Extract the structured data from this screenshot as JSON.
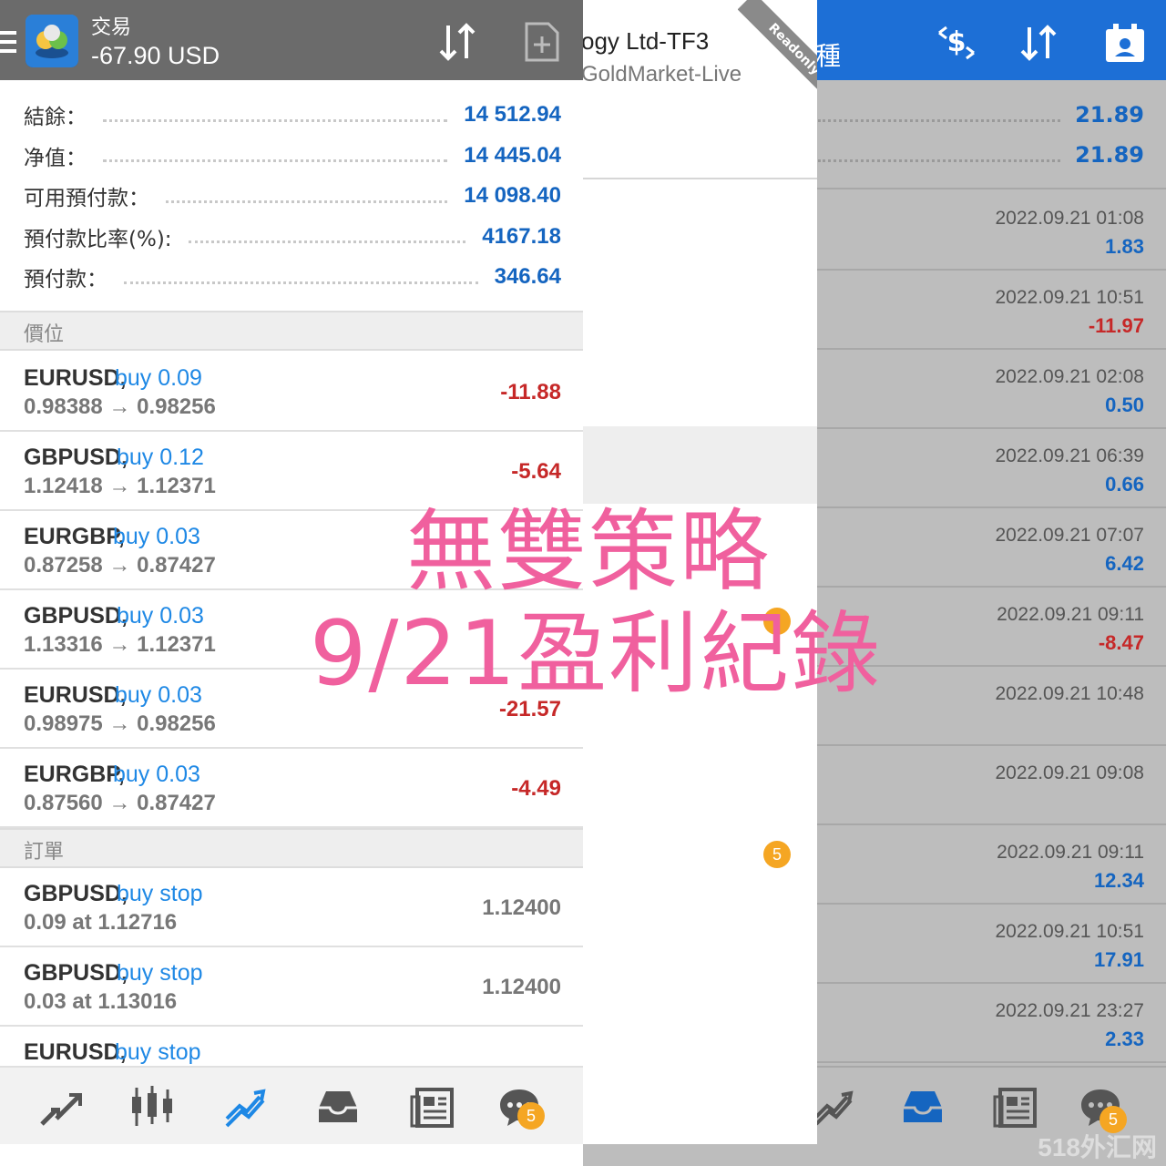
{
  "colors": {
    "header_grey": "#6b6b6b",
    "header_blue": "#1d6fd6",
    "profit_blue": "#1565c0",
    "loss_red": "#c62828",
    "overlay_pink": "#f0609e",
    "badge_orange": "#f5a623"
  },
  "left": {
    "header": {
      "title": "交易",
      "profit": "-67.90 USD",
      "icons": [
        "menu-icon",
        "app-logo-icon",
        "sort-icon",
        "new-order-icon"
      ]
    },
    "account": [
      {
        "label": "結餘：",
        "value": "14 512.94"
      },
      {
        "label": "净值：",
        "value": "14 445.04"
      },
      {
        "label": "可用預付款：",
        "value": "14 098.40"
      },
      {
        "label": "預付款比率(%):",
        "value": "4167.18"
      },
      {
        "label": "預付款：",
        "value": "346.64"
      }
    ],
    "positions_header": "價位",
    "positions": [
      {
        "symbol": "EURUSD,",
        "side": "buy 0.09",
        "prices": "0.98388 → 0.98256",
        "pl": "-11.88"
      },
      {
        "symbol": "GBPUSD,",
        "side": "buy 0.12",
        "prices": "1.12418 → 1.12371",
        "pl": "-5.64"
      },
      {
        "symbol": "EURGBP,",
        "side": "buy 0.03",
        "prices": "0.87258 → 0.87427",
        "pl": ""
      },
      {
        "symbol": "GBPUSD,",
        "side": "buy 0.03",
        "prices": "1.13316 → 1.12371",
        "pl": ""
      },
      {
        "symbol": "EURUSD,",
        "side": "buy 0.03",
        "prices": "0.98975 → 0.98256",
        "pl": "-21.57"
      },
      {
        "symbol": "EURGBP,",
        "side": "buy 0.03",
        "prices": "0.87560 → 0.87427",
        "pl": "-4.49"
      }
    ],
    "orders_header": "訂單",
    "orders": [
      {
        "symbol": "GBPUSD,",
        "side": "buy stop",
        "detail": "0.09 at 1.12716",
        "price": "1.12400"
      },
      {
        "symbol": "GBPUSD,",
        "side": "buy stop",
        "detail": "0.03 at 1.13016",
        "price": "1.12400"
      },
      {
        "symbol": "EURUSD,",
        "side": "buy stop",
        "detail": "",
        "price": ""
      }
    ],
    "bottom_nav": [
      "quotes-icon",
      "chart-icon",
      "trade-icon",
      "history-icon",
      "news-icon",
      "chat-icon"
    ],
    "chat_badge": "5"
  },
  "middle": {
    "company": "ogy Ltd-TF3",
    "server": "GoldMarket-Live",
    "ribbon": "Readonly",
    "badge": "5"
  },
  "right": {
    "header": {
      "partial_title": "種",
      "icons": [
        "currency-exchange-icon",
        "sort-icon",
        "calendar-icon"
      ]
    },
    "summary": [
      "21.89",
      "21.89"
    ],
    "history": [
      {
        "time": "2022.09.21 01:08",
        "amount": "1.83",
        "type": "pos"
      },
      {
        "time": "2022.09.21 10:51",
        "amount": "-11.97",
        "type": "neg"
      },
      {
        "time": "2022.09.21 02:08",
        "amount": "0.50",
        "type": "pos"
      },
      {
        "time": "2022.09.21 06:39",
        "amount": "0.66",
        "type": "pos"
      },
      {
        "time": "2022.09.21 07:07",
        "amount": "6.42",
        "type": "pos"
      },
      {
        "time": "2022.09.21 09:11",
        "amount": "-8.47",
        "type": "neg"
      },
      {
        "time": "2022.09.21 10:48",
        "amount": "",
        "type": "pos"
      },
      {
        "time": "2022.09.21 09:08",
        "amount": "",
        "type": "pos"
      },
      {
        "time": "2022.09.21 09:11",
        "amount": "12.34",
        "type": "pos"
      },
      {
        "time": "2022.09.21 10:51",
        "amount": "17.91",
        "type": "pos"
      },
      {
        "time": "2022.09.21 23:27",
        "amount": "2.33",
        "type": "pos"
      }
    ],
    "bottom_nav": [
      "trade-icon",
      "history-icon",
      "news-icon",
      "chat-icon"
    ],
    "chat_badge": "5"
  },
  "overlay": {
    "line1": "無雙策略",
    "line2": "9/21盈利紀錄"
  },
  "watermark": "518外汇网"
}
